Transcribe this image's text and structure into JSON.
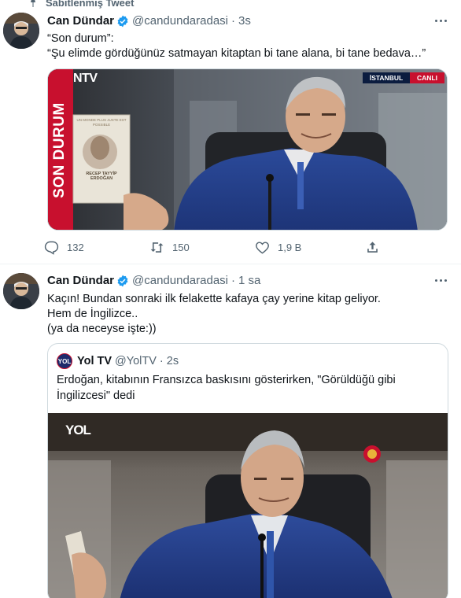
{
  "pinned_label": "Sabitlenmiş Tweet",
  "tweets": [
    {
      "author": "Can Dündar",
      "handle": "@candundaradasi",
      "time": "3s",
      "text_line1": "“Son durum”:",
      "text_line2": "“Şu elimde gördüğünüz satmayan kitaptan bi tane alana, bi tane bedava…”",
      "media": {
        "channel_logo": "NTV",
        "location_tag": "İSTANBUL",
        "live_tag": "CANLI",
        "banner_text": "SON DURUM",
        "book_author": "RECEP TAYYİP ERDOĞAN",
        "book_title": "UN MONDE PLUS JUSTE EST POSSIBLE"
      },
      "replies": "132",
      "retweets": "150",
      "likes": "1,9 B"
    },
    {
      "author": "Can Dündar",
      "handle": "@candundaradasi",
      "time": "1 sa",
      "text_line1": "Kaçın! Bundan sonraki ilk felakette kafaya çay yerine kitap geliyor.",
      "text_line2": "Hem de İngilizce..",
      "text_line3": "(ya da neceyse işte:))",
      "quote": {
        "avatar_text": "YOL",
        "author": "Yol TV",
        "handle": "@YolTV",
        "time": "2s",
        "text": "Erdoğan, kitabının Fransızca baskısını gösterirken, \"Görüldüğü gibi İngilizcesi\" dedi",
        "media_logo": "YOL"
      }
    }
  ],
  "colors": {
    "accent": "#1d9bf0",
    "muted": "#536471",
    "ntv_red": "#c8102e"
  }
}
